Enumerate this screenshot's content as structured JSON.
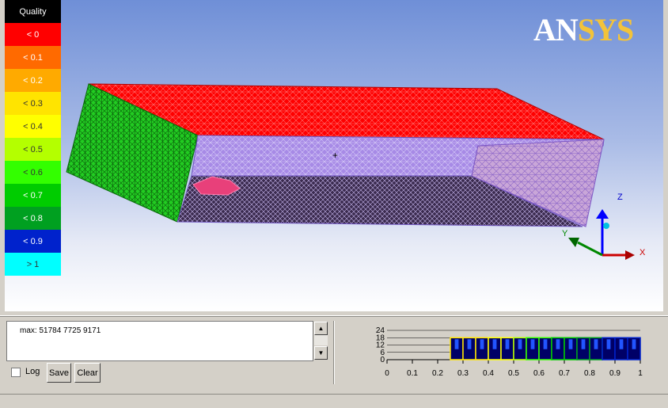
{
  "legend": {
    "title": "Quality",
    "items": [
      {
        "label": "< 0",
        "color": "#ff0000"
      },
      {
        "label": "< 0.1",
        "color": "#ff6a00"
      },
      {
        "label": "< 0.2",
        "color": "#ffaa00"
      },
      {
        "label": "< 0.3",
        "color": "#ffe400"
      },
      {
        "label": "< 0.4",
        "color": "#ffff00"
      },
      {
        "label": "< 0.5",
        "color": "#b4ff00"
      },
      {
        "label": "< 0.6",
        "color": "#33ff00"
      },
      {
        "label": "< 0.7",
        "color": "#00cc00"
      },
      {
        "label": "< 0.8",
        "color": "#00a020"
      },
      {
        "label": "< 0.9",
        "color": "#0022cc"
      },
      {
        "label": "> 1",
        "color": "#00ffff"
      }
    ]
  },
  "logo": {
    "part1": "AN",
    "part2": "SYS"
  },
  "axes": {
    "x": "X",
    "y": "Y",
    "z": "Z"
  },
  "log_panel": {
    "text": "max: 51784 7725 9171",
    "scroll_up": "▲",
    "scroll_down": "▼"
  },
  "controls": {
    "log_label": "Log",
    "save_label": "Save",
    "clear_label": "Clear"
  },
  "histogram": {
    "y_ticks": [
      "24",
      "18",
      "12",
      "6",
      "0"
    ],
    "x_ticks": [
      "0",
      "0.1",
      "0.2",
      "0.3",
      "0.4",
      "0.5",
      "0.6",
      "0.7",
      "0.8",
      "0.9",
      "1"
    ],
    "bars": [
      {
        "x": 0.25,
        "value": 18,
        "color": "#ffe400"
      },
      {
        "x": 0.3,
        "value": 18,
        "color": "#ffe400"
      },
      {
        "x": 0.35,
        "value": 18,
        "color": "#ffe400"
      },
      {
        "x": 0.4,
        "value": 18,
        "color": "#ffff00"
      },
      {
        "x": 0.45,
        "value": 18,
        "color": "#ffff00"
      },
      {
        "x": 0.5,
        "value": 18,
        "color": "#b4ff00"
      },
      {
        "x": 0.55,
        "value": 18,
        "color": "#33ff00"
      },
      {
        "x": 0.6,
        "value": 18,
        "color": "#33ff00"
      },
      {
        "x": 0.65,
        "value": 18,
        "color": "#00cc00"
      },
      {
        "x": 0.7,
        "value": 18,
        "color": "#00cc00"
      },
      {
        "x": 0.75,
        "value": 18,
        "color": "#00a020"
      },
      {
        "x": 0.8,
        "value": 18,
        "color": "#00a020"
      },
      {
        "x": 0.85,
        "value": 18,
        "color": "#0022cc"
      },
      {
        "x": 0.9,
        "value": 18,
        "color": "#0022cc"
      },
      {
        "x": 0.95,
        "value": 18,
        "color": "#0022cc"
      }
    ]
  }
}
